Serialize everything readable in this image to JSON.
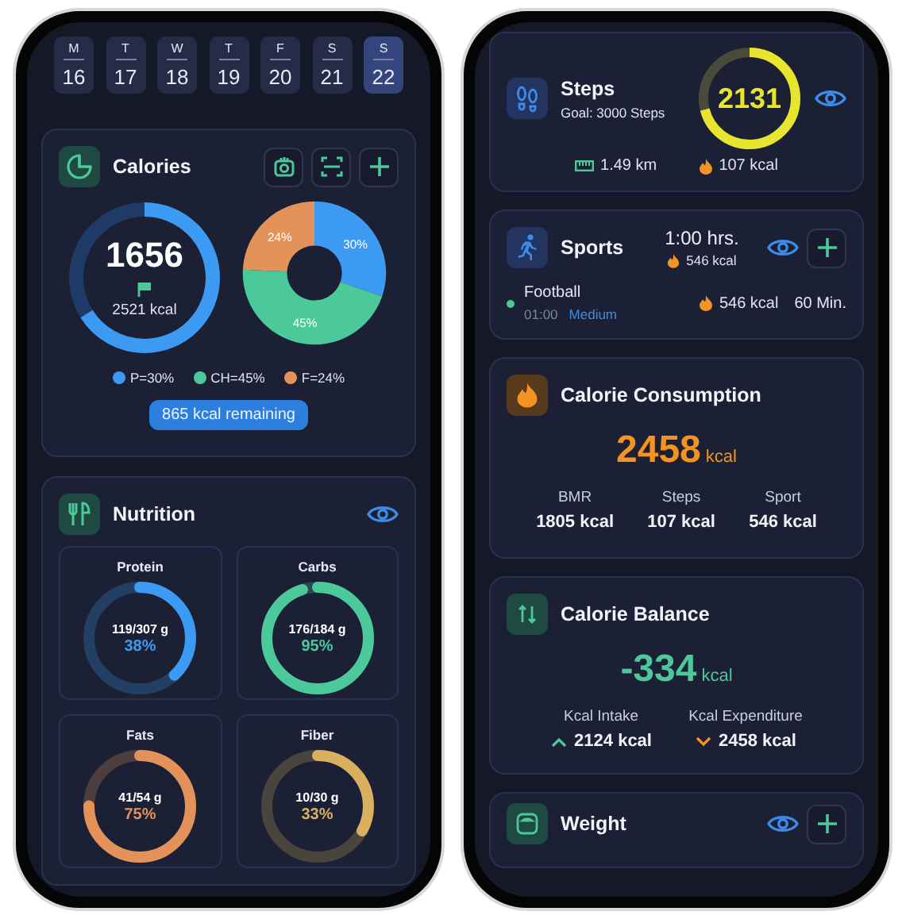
{
  "left": {
    "days": [
      {
        "weekday": "M",
        "date": "16",
        "selected": false
      },
      {
        "weekday": "T",
        "date": "17",
        "selected": false
      },
      {
        "weekday": "W",
        "date": "18",
        "selected": false
      },
      {
        "weekday": "T",
        "date": "19",
        "selected": false
      },
      {
        "weekday": "F",
        "date": "20",
        "selected": false
      },
      {
        "weekday": "S",
        "date": "21",
        "selected": false
      },
      {
        "weekday": "S",
        "date": "22",
        "selected": true
      }
    ],
    "calories": {
      "title": "Calories",
      "value": "1656",
      "goal": "2521 kcal",
      "level": 0.66,
      "chart_data": {
        "type": "donut",
        "values": [
          30,
          45,
          24
        ],
        "value_labels": [
          "30%",
          "45%",
          "24%"
        ]
      },
      "legend": [
        {
          "label": "P=30%",
          "color": "#3d9af2"
        },
        {
          "label": "CH=45%",
          "color": "#4cc99b"
        },
        {
          "label": "F=24%",
          "color": "#e3935a"
        }
      ],
      "remaining": "865 kcal remaining"
    },
    "nutrition": {
      "title": "Nutrition",
      "items": [
        {
          "name": "Protein",
          "amount": "119/307 g",
          "percent": "38%",
          "level": 0.38,
          "color": "#3d9af2"
        },
        {
          "name": "Carbs",
          "amount": "176/184 g",
          "percent": "95%",
          "level": 0.95,
          "color": "#4cc99b"
        },
        {
          "name": "Fats",
          "amount": "41/54 g",
          "percent": "75%",
          "level": 0.75,
          "color": "#e3935a"
        },
        {
          "name": "Fiber",
          "amount": "10/30 g",
          "percent": "33%",
          "level": 0.33,
          "color": "#d8b060"
        }
      ]
    }
  },
  "right": {
    "steps": {
      "title": "Steps",
      "goal": "Goal: 3000 Steps",
      "count": "2131",
      "level": 0.71,
      "distance": "1.49 km",
      "kcal": "107 kcal"
    },
    "sports": {
      "title": "Sports",
      "duration": "1:00 hrs.",
      "kcal": "546 kcal",
      "activities": [
        {
          "name": "Football",
          "time": "01:00",
          "intensity": "Medium",
          "kcal": "546 kcal",
          "minutes": "60 Min.",
          "color": "#4cc99b"
        }
      ]
    },
    "consumption": {
      "title": "Calorie Consumption",
      "value": "2458",
      "unit": "kcal",
      "breakdown": [
        {
          "label": "BMR",
          "value": "1805 kcal"
        },
        {
          "label": "Steps",
          "value": "107 kcal"
        },
        {
          "label": "Sport",
          "value": "546 kcal"
        }
      ]
    },
    "balance": {
      "title": "Calorie Balance",
      "value": "-334",
      "unit": "kcal",
      "items": [
        {
          "label": "Kcal Intake",
          "value": "2124 kcal",
          "kind": "up"
        },
        {
          "label": "Kcal Expenditure",
          "value": "2458 kcal",
          "kind": "down"
        }
      ]
    },
    "weight": {
      "title": "Weight"
    }
  }
}
